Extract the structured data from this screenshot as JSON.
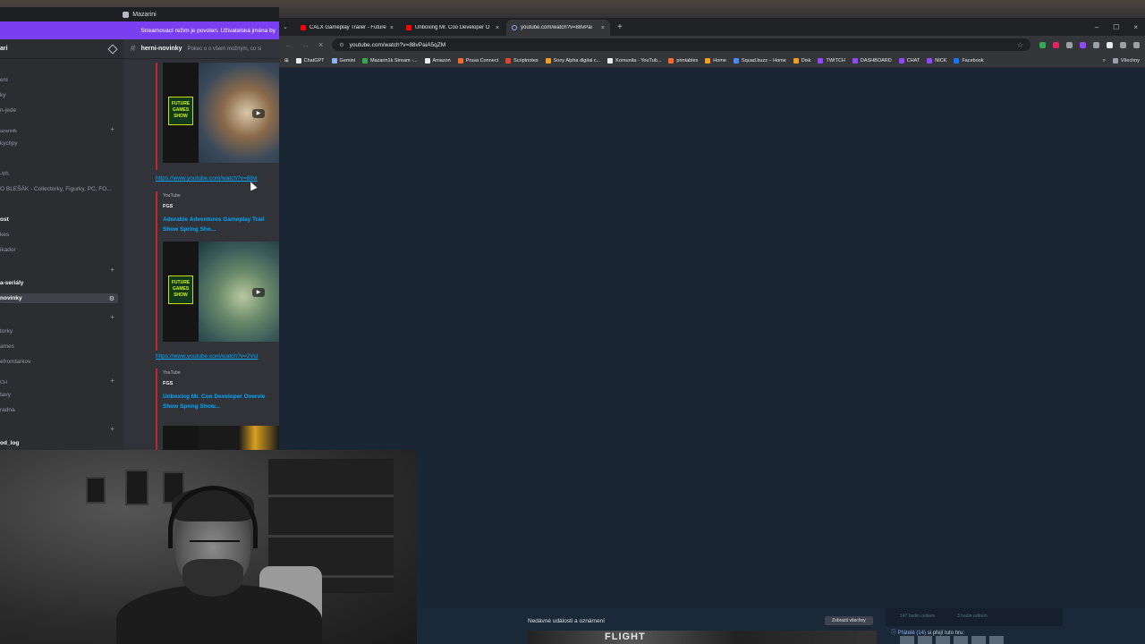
{
  "discord": {
    "window_title": "Mazarini",
    "banner_text": "Streamovací režim je povolen. Uživatelská jména by",
    "server_name": "ari",
    "sidebar_channels": [
      {
        "label": "eni",
        "type": "channel"
      },
      {
        "label": "ky",
        "type": "channel"
      },
      {
        "label": "n-jede",
        "type": "channel"
      },
      {
        "label": "azarinlk",
        "type": "category"
      },
      {
        "label": "kyclipy",
        "type": "channel"
      },
      {
        "label": "-trh",
        "type": "channel"
      },
      {
        "label": "O BLEŠÁK - Collectorky, Figurky, PC, FO...",
        "type": "channel"
      },
      {
        "label": "ost",
        "type": "bold"
      },
      {
        "label": "kes",
        "type": "channel"
      },
      {
        "label": "ikador",
        "type": "channel"
      },
      {
        "label": "a-seriály",
        "type": "bold"
      },
      {
        "label": "novinky",
        "type": "active"
      },
      {
        "label": "torky",
        "type": "channel"
      },
      {
        "label": "ames",
        "type": "channel"
      },
      {
        "label": "efromtarkov",
        "type": "channel"
      },
      {
        "label": "CH",
        "type": "category"
      },
      {
        "label": "tavy",
        "type": "channel"
      },
      {
        "label": "radna",
        "type": "channel"
      },
      {
        "label": "od_log",
        "type": "bold"
      }
    ],
    "channel_name": "herni-novinky",
    "channel_topic": "Pokec o o všem možným, co si",
    "messages": [
      {
        "link": "",
        "source": "",
        "author": "",
        "title": ""
      },
      {
        "link": "https://www.youtube.com/watch?v=88vl",
        "source": "YouTube",
        "author": "FGS",
        "title_line1": "Adorable Adventures Gameplay Trail",
        "title_line2": "Show Spring Sho..."
      },
      {
        "link": "https://www.youtube.com/watch?v=2Vsl",
        "source": "YouTube",
        "author": "FGS",
        "title_line1": "Unboxing Mr. Coo Developer Overvie",
        "title_line2": "Show Spring Show..."
      }
    ],
    "thumb_badge": "FUTURE GAMES SHOW"
  },
  "browser": {
    "tabs": [
      {
        "label": "CALX Gameplay Trailer - Future",
        "active": false
      },
      {
        "label": "Unboxing Mr. Coo Developer O",
        "active": false
      },
      {
        "label": "youtube.com/watch?v=88vPai",
        "active": true
      }
    ],
    "url": "youtube.com/watch?v=88vPaiA5qZM",
    "bookmarks": [
      "ChatGPT",
      "Gemini",
      "Mazarin1k Stream -...",
      "Amazon",
      "Prusa Connect",
      "Scriptnotes",
      "Sony Alpha digital c...",
      "Komunita - YouTub...",
      "printables",
      "Home",
      "Squad.buzz – Home",
      "Disk",
      "TWITCH",
      "DASHBOARD",
      "CHAT",
      "NICK",
      "Facebook"
    ],
    "all_bookmarks": "Všechny"
  },
  "steam": {
    "events_header": "Nedávné události a oznámení",
    "show_all": "Zobrazit všechny",
    "banner_text": "FLIGHT",
    "friends_label": "Přátelé (14)",
    "friends_suffix": " si přejí tuto hru:",
    "side_left": "147 hodin celkem",
    "side_right": "3 hodin celkem"
  },
  "colors": {
    "discord_accent": "#7b3ff2",
    "link": "#00a8fc",
    "embed_border": "#c4242c",
    "page_bg": "#1b2634"
  }
}
